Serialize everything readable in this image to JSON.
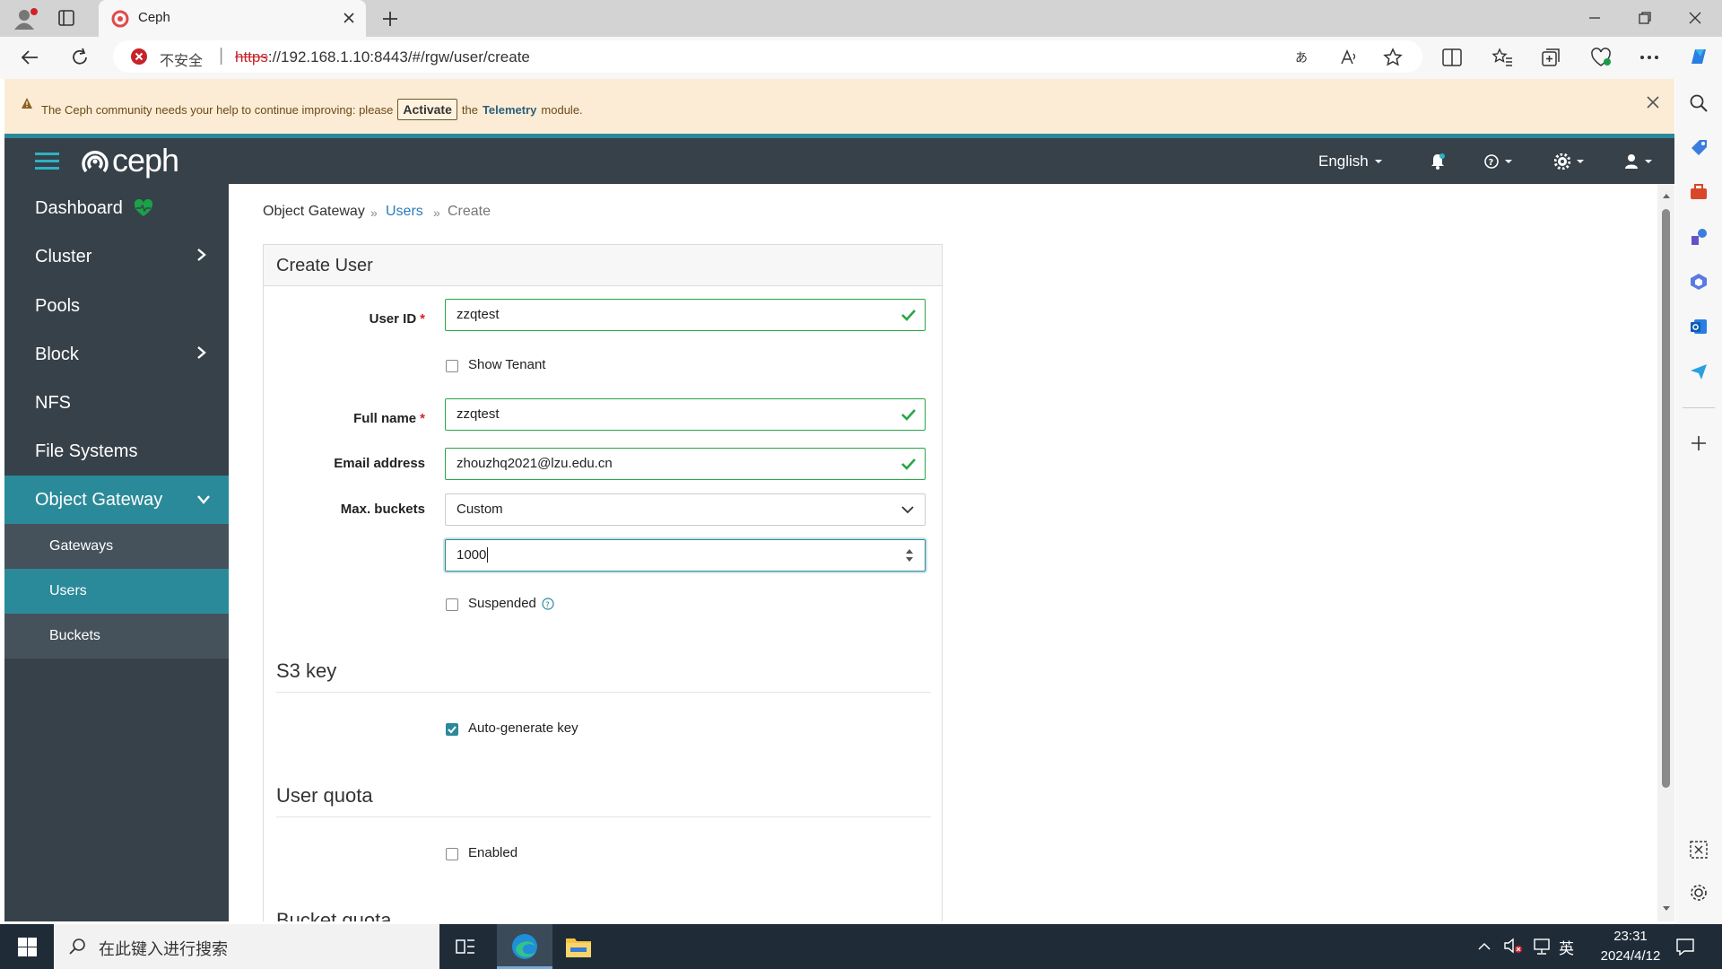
{
  "browser": {
    "tab_title": "Ceph",
    "security_label": "不安全",
    "url_scheme": "https",
    "url_rest": "://192.168.1.10:8443/#/rgw/user/create"
  },
  "notice": {
    "text_before": "The Ceph community needs your help to continue improving: please",
    "activate_label": "Activate",
    "text_the": "the",
    "telemetry": "Telemetry",
    "text_after": "module."
  },
  "header": {
    "logo_text": "ceph",
    "language": "English"
  },
  "sidebar": {
    "items": [
      {
        "label": "Dashboard"
      },
      {
        "label": "Cluster"
      },
      {
        "label": "Pools"
      },
      {
        "label": "Block"
      },
      {
        "label": "NFS"
      },
      {
        "label": "File Systems"
      },
      {
        "label": "Object Gateway"
      }
    ],
    "sub_items": [
      {
        "label": "Gateways"
      },
      {
        "label": "Users"
      },
      {
        "label": "Buckets"
      }
    ]
  },
  "breadcrumb": {
    "root": "Object Gateway",
    "users": "Users",
    "current": "Create"
  },
  "form": {
    "title": "Create User",
    "user_id_label": "User ID",
    "user_id_value": "zzqtest",
    "show_tenant_label": "Show Tenant",
    "full_name_label": "Full name",
    "full_name_value": "zzqtest",
    "email_label": "Email address",
    "email_value": "zhouzhq2021@lzu.edu.cn",
    "max_buckets_label": "Max. buckets",
    "max_buckets_mode": "Custom",
    "max_buckets_value": "1000",
    "suspended_label": "Suspended",
    "s3_key_title": "S3 key",
    "auto_generate_label": "Auto-generate key",
    "auto_generate_checked": true,
    "user_quota_title": "User quota",
    "enabled_label": "Enabled",
    "bucket_quota_title": "Bucket quota"
  },
  "taskbar": {
    "search_placeholder": "在此键入进行搜索",
    "ime": "英",
    "time": "23:31",
    "date": "2024/4/12"
  },
  "colors": {
    "sidebar_bg": "#374149",
    "active_teal": "#2b8a99",
    "valid_green": "#28a745",
    "link_blue": "#2b7bb9",
    "notice_bg": "#fcecd6"
  }
}
